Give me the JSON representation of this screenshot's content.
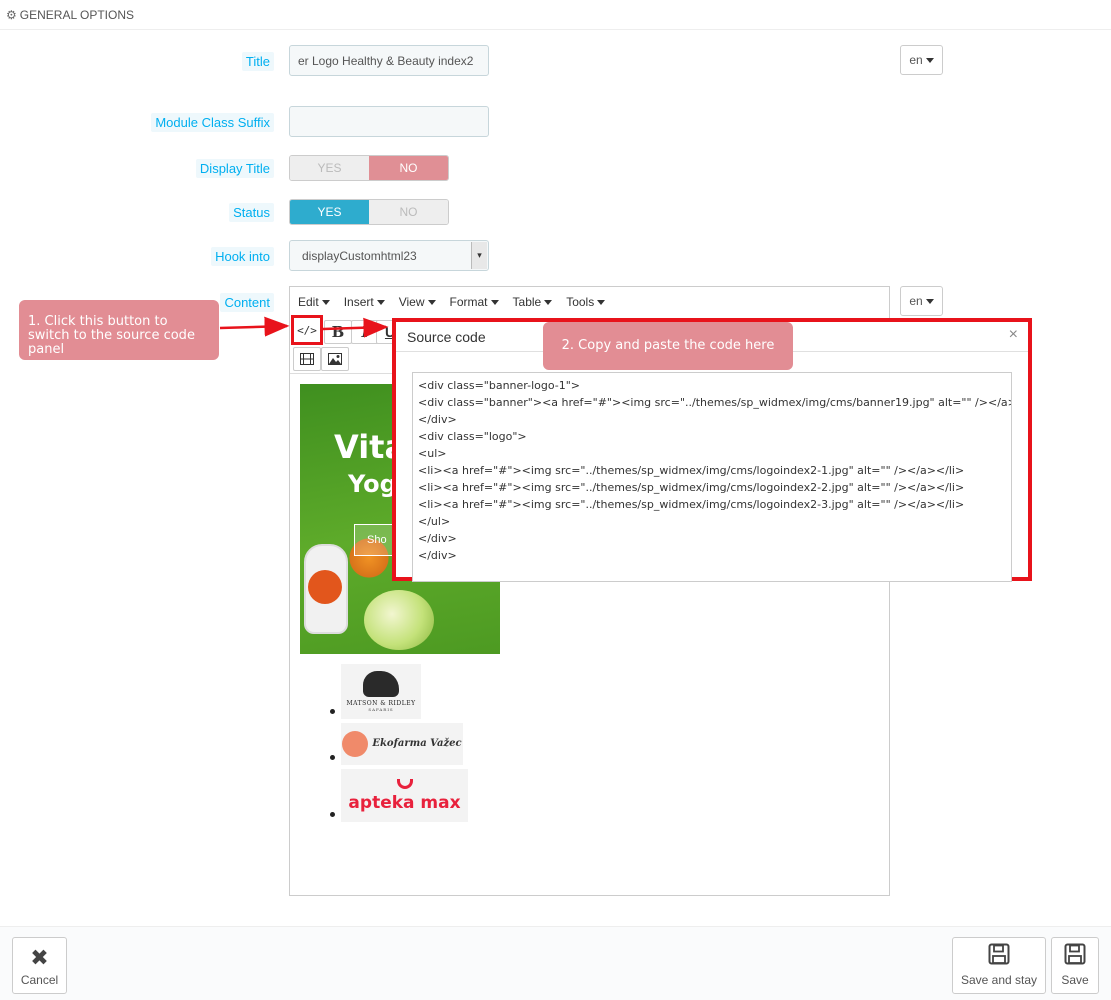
{
  "header": {
    "title": "GENERAL OPTIONS",
    "icon": "gears-icon"
  },
  "form": {
    "title_label": "Title",
    "title_value": "er Logo Healthy & Beauty index2",
    "lang": "en",
    "suffix_label": "Module Class Suffix",
    "suffix_value": "",
    "display_title_label": "Display Title",
    "display_title": {
      "yes": "YES",
      "no": "NO",
      "selected": "NO"
    },
    "status_label": "Status",
    "status": {
      "yes": "YES",
      "no": "NO",
      "selected": "YES"
    },
    "hook_label": "Hook into",
    "hook_value": "displayCustomhtml23",
    "content_label": "Content",
    "content_lang": "en"
  },
  "editor": {
    "menu": [
      "Edit",
      "Insert",
      "View",
      "Format",
      "Table",
      "Tools"
    ],
    "tools": {
      "source": "</>",
      "bold": "B",
      "italic": "I",
      "underline": "U"
    },
    "banner": {
      "title": "Vita",
      "subtitle": "Yog",
      "button": "Sho"
    },
    "logos": [
      {
        "name": "MATSON & RIDLEY",
        "sub": "SAFARIS"
      },
      {
        "name": "Ekofarma Važec"
      },
      {
        "name": "apteka max"
      }
    ]
  },
  "annotations": {
    "step1": "1. Click this button to switch to the source code panel",
    "step2": "2. Copy and paste the code here",
    "accent": "#e8131b"
  },
  "dialog": {
    "title": "Source code",
    "close": "×",
    "code": "<div class=\"banner-logo-1\">\n<div class=\"banner\"><a href=\"#\"><img src=\"../themes/sp_widmex/img/cms/banner19.jpg\" alt=\"\" /></a>\n</div>\n<div class=\"logo\">\n<ul>\n<li><a href=\"#\"><img src=\"../themes/sp_widmex/img/cms/logoindex2-1.jpg\" alt=\"\" /></a></li>\n<li><a href=\"#\"><img src=\"../themes/sp_widmex/img/cms/logoindex2-2.jpg\" alt=\"\" /></a></li>\n<li><a href=\"#\"><img src=\"../themes/sp_widmex/img/cms/logoindex2-3.jpg\" alt=\"\" /></a></li>\n</ul>\n</div>\n</div>"
  },
  "footer": {
    "cancel": "Cancel",
    "save_stay": "Save and stay",
    "save": "Save"
  }
}
